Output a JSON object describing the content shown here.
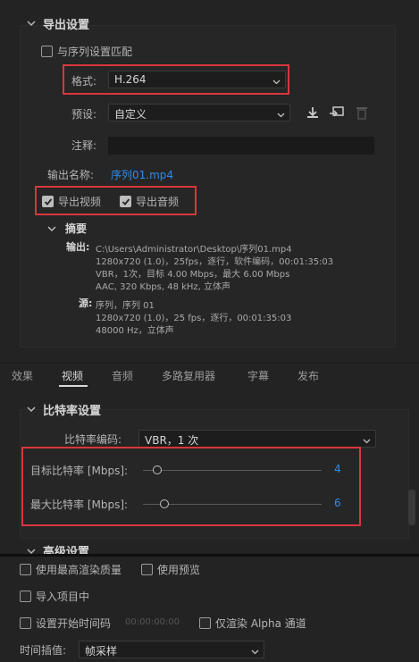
{
  "export_settings": {
    "section_title": "导出设置",
    "match_sequence_label": "与序列设置匹配",
    "format_label": "格式:",
    "format_value": "H.264",
    "preset_label": "预设:",
    "preset_value": "自定义",
    "comments_label": "注释:",
    "comments_value": "",
    "output_name_label": "输出名称:",
    "output_name_value": "序列01.mp4",
    "export_video_label": "导出视频",
    "export_audio_label": "导出音频",
    "export_video_checked": true,
    "export_audio_checked": true,
    "match_sequence_checked": false
  },
  "summary": {
    "title": "摘要",
    "output_label": "输出:",
    "output_lines": [
      "C:\\Users\\Administrator\\Desktop\\序列01.mp4",
      "1280x720 (1.0)，25fps，逐行，软件编码，00:01:35:03",
      "VBR，1次，目标 4.00 Mbps，最大 6.00 Mbps",
      "AAC, 320 Kbps, 48  kHz, 立体声"
    ],
    "source_label": "源:",
    "source_lines": [
      "序列，序列 01",
      "1280x720 (1.0)，25 fps，逐行，00:01:35:03",
      "48000 Hz，立体声"
    ]
  },
  "tabs": [
    {
      "label": "效果",
      "active": false
    },
    {
      "label": "视频",
      "active": true
    },
    {
      "label": "音频",
      "active": false
    },
    {
      "label": "多路复用器",
      "active": false
    },
    {
      "label": "字幕",
      "active": false
    },
    {
      "label": "发布",
      "active": false
    }
  ],
  "bitrate": {
    "section_title": "比特率设置",
    "encoding_label": "比特率编码:",
    "encoding_value": "VBR，1 次",
    "target_label": "目标比特率 [Mbps]:",
    "target_value": "4",
    "target_fraction": 0.08,
    "max_label": "最大比特率 [Mbps]:",
    "max_value": "6",
    "max_fraction": 0.12
  },
  "advanced": {
    "section_title": "高级设置"
  },
  "bottom": {
    "max_render_quality_label": "使用最高渲染质量",
    "use_previews_label": "使用预览",
    "import_into_project_label": "导入项目中",
    "set_start_timecode_label": "设置开始时间码",
    "start_timecode_value": "00:00:00:00",
    "render_alpha_only_label": "仅渲染 Alpha 通道",
    "time_interpolation_label": "时间插值:",
    "time_interpolation_value": "帧采样"
  },
  "colors": {
    "highlight": "#d9363e",
    "link": "#2d8ceb"
  }
}
